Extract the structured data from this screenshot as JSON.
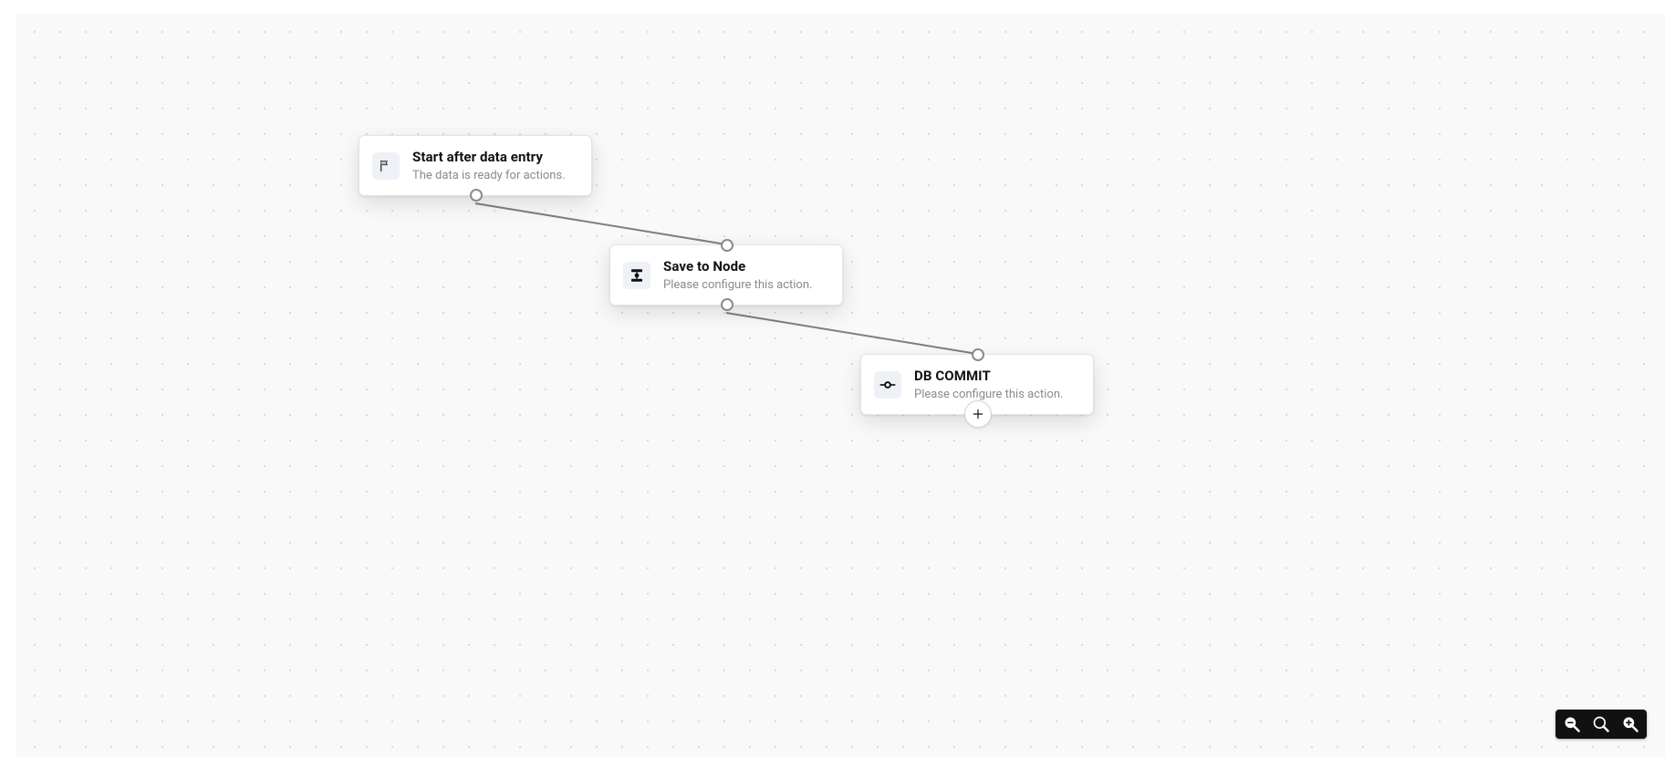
{
  "nodes": {
    "start": {
      "title": "Start after data entry",
      "subtitle": "The data is ready for actions.",
      "icon": "flag-icon"
    },
    "save": {
      "title": "Save to Node",
      "subtitle": "Please configure this action.",
      "icon": "node-down-icon"
    },
    "commit": {
      "title": "DB COMMIT",
      "subtitle": "Please configure this action.",
      "icon": "commit-icon"
    }
  },
  "zoom": {
    "out_label": "Zoom out",
    "reset_label": "Reset zoom",
    "in_label": "Zoom in"
  }
}
